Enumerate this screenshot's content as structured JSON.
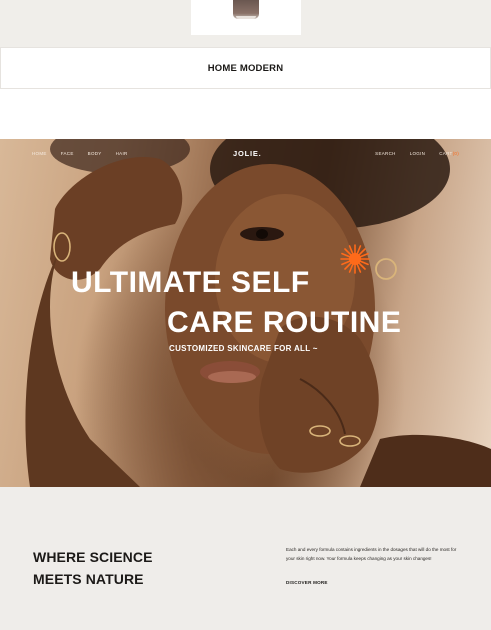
{
  "top": {
    "caption": "HOME MODERN"
  },
  "hero": {
    "nav_left": [
      "HOME",
      "FACE",
      "BODY",
      "HAIR"
    ],
    "brand": "JOLIE.",
    "nav_right": {
      "search": "SEARCH",
      "login": "LOGIN",
      "cart": "CART",
      "cart_count": "(0)"
    },
    "headline_line1": "ULTIMATE SELF",
    "headline_line2": "CARE ROUTINE",
    "subheadline": "CUSTOMIZED SKINCARE FOR ALL ~",
    "accent_color": "#ff6a1a"
  },
  "bottom": {
    "heading_line1": "WHERE SCIENCE",
    "heading_line2": "MEETS NATURE",
    "paragraph": "Each and every formula contains ingredients in the dosages that will do the most for your skin right now. Your formula keeps changing as your skin changes!",
    "cta": "DISCOVER MORE"
  }
}
